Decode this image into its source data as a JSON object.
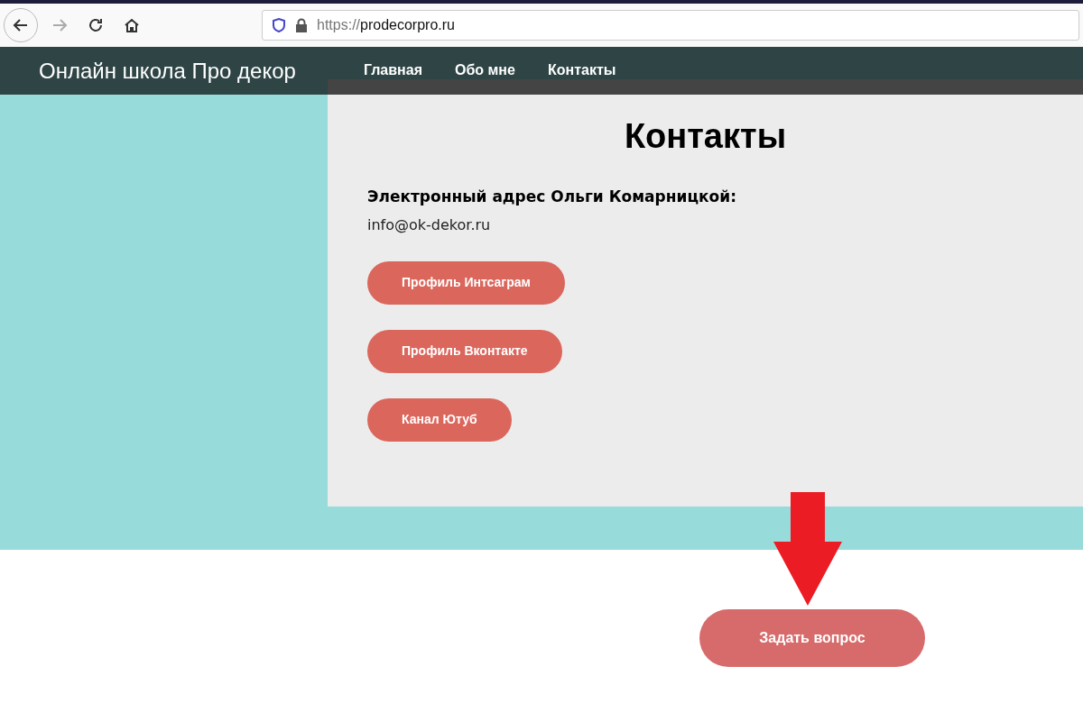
{
  "browser": {
    "url_scheme": "https://",
    "url_host": "prodecorpro.ru"
  },
  "site": {
    "title": "Онлайн школа Про декор",
    "nav": [
      {
        "label": "Главная"
      },
      {
        "label": "Обо мне"
      },
      {
        "label": "Контакты"
      }
    ]
  },
  "contacts": {
    "heading": "Контакты",
    "email_label": "Электронный адрес Ольги Комарницкой:",
    "email": "info@ok-dekor.ru",
    "buttons": [
      {
        "label": "Профиль Интсаграм"
      },
      {
        "label": "Профиль Вконтакте"
      },
      {
        "label": "Канал Ютуб"
      }
    ]
  },
  "ask_button": {
    "label": "Задать вопрос"
  }
}
